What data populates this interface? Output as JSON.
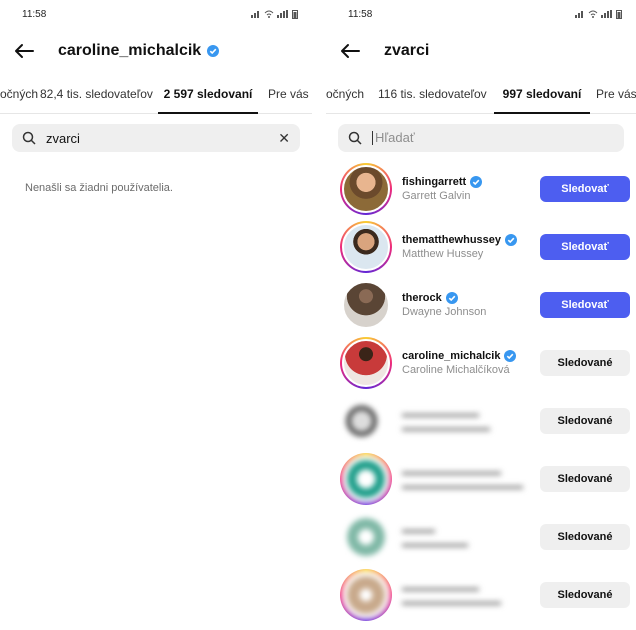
{
  "colors": {
    "accent": "#4d5ef0",
    "verified": "#3897f0"
  },
  "left": {
    "status_time": "11:58",
    "header_title": "caroline_michalcik",
    "tabs": [
      "očných",
      "82,4 tis. sledovateľov",
      "2 597 sledovaní",
      "Pre vás"
    ],
    "search_value": "zvarci",
    "empty_message": "Nenašli sa žiadni používatelia."
  },
  "right": {
    "status_time": "11:58",
    "header_title": "zvarci",
    "tabs": [
      "očných",
      "116 tis. sledovateľov",
      "997 sledovaní",
      "Pre vás"
    ],
    "search_placeholder": "Hľadať",
    "users": [
      {
        "username": "fishingarrett",
        "fullname": "Garrett Galvin",
        "verified": true,
        "button": "Sledovať"
      },
      {
        "username": "thematthewhussey",
        "fullname": "Matthew Hussey",
        "verified": true,
        "button": "Sledovať"
      },
      {
        "username": "therock",
        "fullname": "Dwayne Johnson",
        "verified": true,
        "button": "Sledovať"
      },
      {
        "username": "caroline_michalcik",
        "fullname": "Caroline Michalčíková",
        "verified": true,
        "button": "Sledované"
      },
      {
        "username": "",
        "fullname": "",
        "verified": false,
        "button": "Sledované"
      },
      {
        "username": "",
        "fullname": "",
        "verified": false,
        "button": "Sledované"
      },
      {
        "username": "",
        "fullname": "",
        "verified": false,
        "button": "Sledované"
      },
      {
        "username": "",
        "fullname": "",
        "verified": false,
        "button": "Sledované"
      }
    ]
  }
}
